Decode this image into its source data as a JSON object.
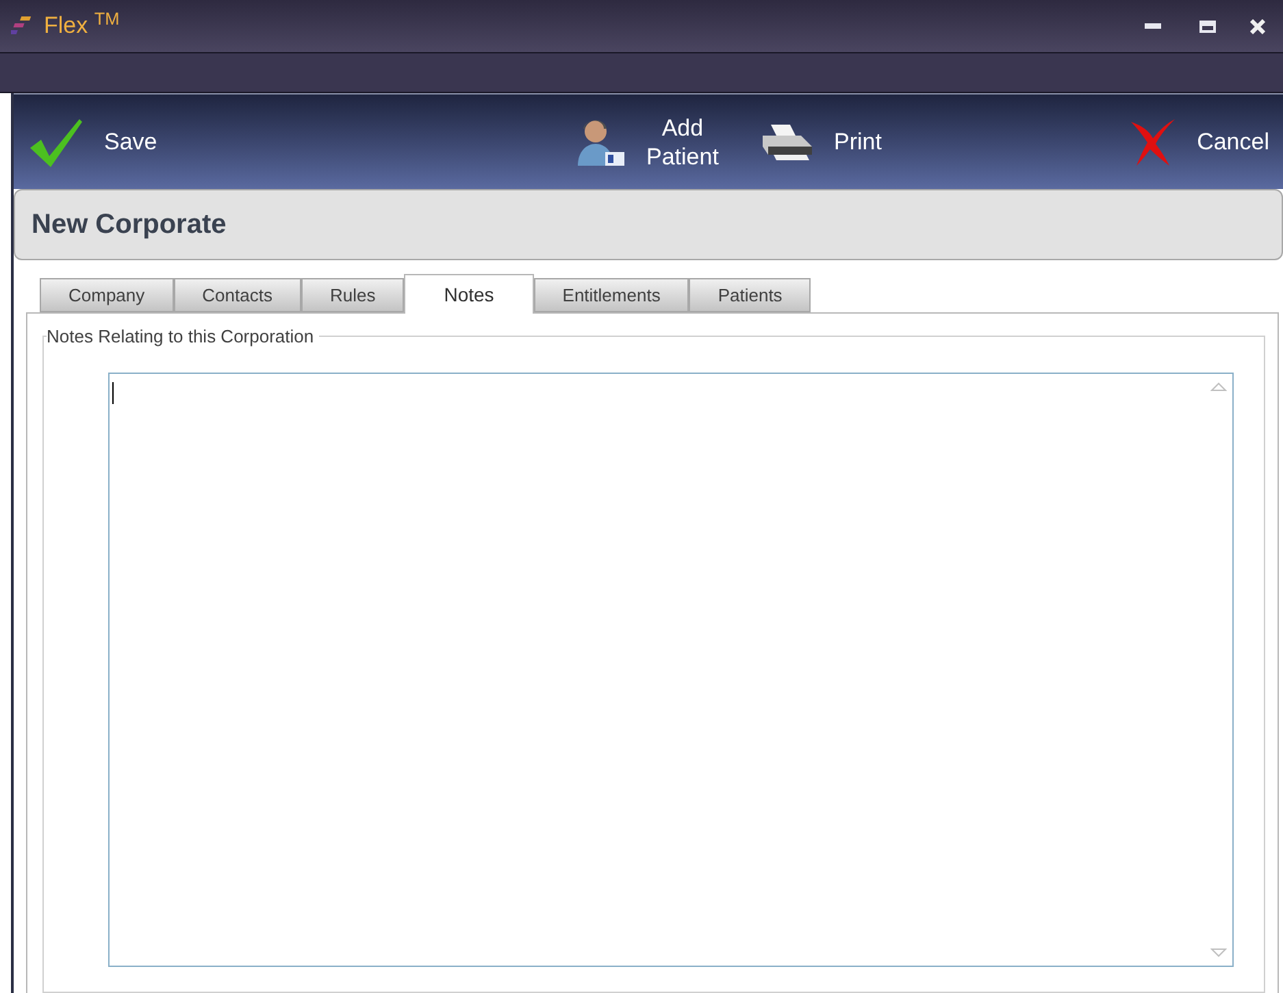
{
  "window": {
    "title": "Flex $^{TM}$"
  },
  "toolbar": [
    {
      "kind": "save",
      "label": "Save"
    },
    {
      "kind": "add-patient",
      "label": "Add\nPatient"
    },
    {
      "kind": "print",
      "label": "Print"
    },
    {
      "kind": "cancel",
      "label": "Cancel"
    }
  ],
  "header": {
    "title": "New Corporate"
  },
  "tabs": [
    {
      "label": "Company",
      "selected": false
    },
    {
      "label": "Contacts",
      "selected": false
    },
    {
      "label": "Rules",
      "selected": false
    },
    {
      "label": "Notes",
      "selected": true
    },
    {
      "label": "Entitlements",
      "selected": false
    },
    {
      "label": "Patients",
      "selected": false
    }
  ],
  "notes_group": {
    "title": "Notes Relating to this Corporation"
  }
}
